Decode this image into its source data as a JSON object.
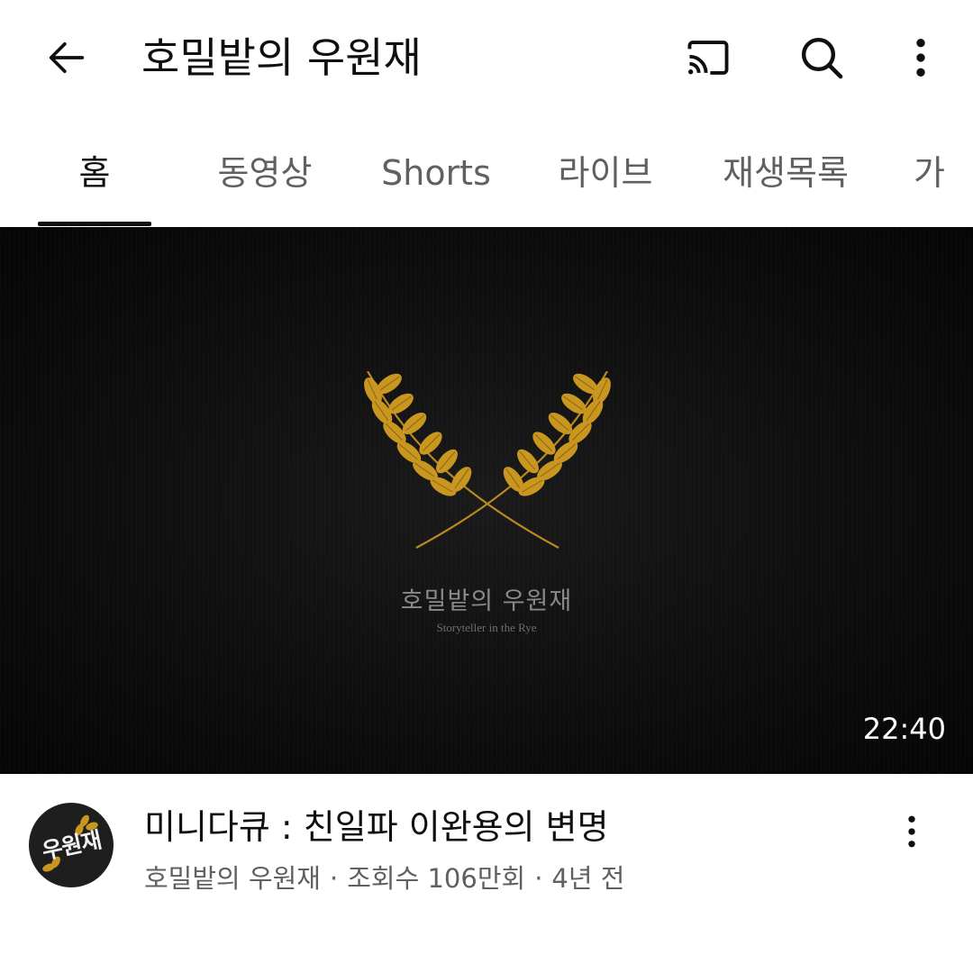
{
  "header": {
    "title": "호밀밭의 우원재",
    "back_icon": "arrow-left-icon",
    "cast_icon": "cast-icon",
    "search_icon": "search-icon",
    "menu_icon": "more-vertical-icon"
  },
  "tabs": [
    {
      "label": "홈",
      "active": true
    },
    {
      "label": "동영상",
      "active": false
    },
    {
      "label": "Shorts",
      "active": false
    },
    {
      "label": "라이브",
      "active": false
    },
    {
      "label": "재생목록",
      "active": false
    },
    {
      "label": "가",
      "active": false
    }
  ],
  "video": {
    "thumbnail_title": "호밀밭의 우원재",
    "thumbnail_subtitle": "Storyteller in the Rye",
    "duration": "22:40",
    "title": "미니다큐 : 친일파 이완용의 변명",
    "channel": "호밀밭의 우원재",
    "separator": "·",
    "views": "조회수 106만회",
    "age": "4년 전",
    "avatar_text": "우원재",
    "more_icon": "more-vertical-icon"
  },
  "colors": {
    "text_primary": "#0f0f0f",
    "text_secondary": "#606060",
    "wheat_gold": "#c9971f",
    "thumbnail_bg": "#111111"
  }
}
